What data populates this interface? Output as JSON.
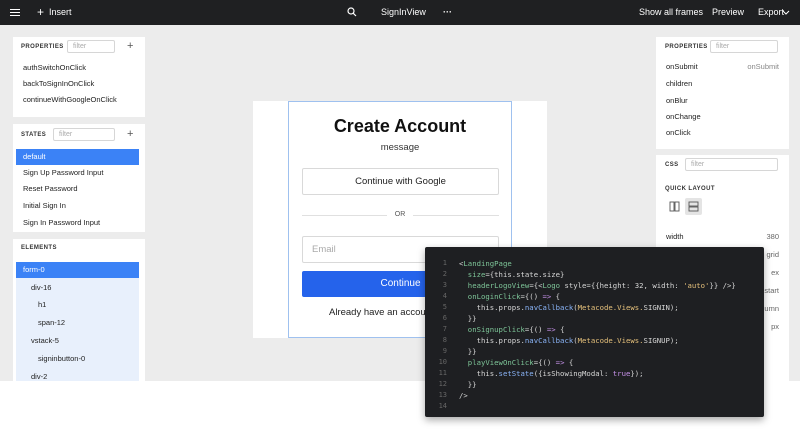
{
  "topbar": {
    "insert_label": "Insert",
    "view_name": "SignInView",
    "more_label": "···",
    "show_all_frames": "Show all frames",
    "preview": "Preview",
    "export": "Export"
  },
  "left_properties": {
    "title": "PROPERTIES",
    "filter_placeholder": "filter",
    "items": [
      "authSwitchOnClick",
      "backToSignInOnClick",
      "continueWithGoogleOnClick"
    ]
  },
  "states": {
    "title": "STATES",
    "filter_placeholder": "filter",
    "items": [
      "default",
      "Sign Up Password Input",
      "Reset Password",
      "Initial Sign In",
      "Sign In Password Input"
    ]
  },
  "elements": {
    "title": "ELEMENTS",
    "items": [
      "form-0",
      "div-16",
      "h1",
      "span-12",
      "vstack-5",
      "signinbutton-0",
      "div-2"
    ]
  },
  "right_properties": {
    "title": "PROPERTIES",
    "filter_placeholder": "filter",
    "items": [
      {
        "name": "onSubmit",
        "value": "onSubmit"
      },
      {
        "name": "children",
        "value": ""
      },
      {
        "name": "onBlur",
        "value": ""
      },
      {
        "name": "onChange",
        "value": ""
      },
      {
        "name": "onClick",
        "value": ""
      }
    ]
  },
  "css_panel": {
    "title": "CSS",
    "filter_placeholder": "filter",
    "quick_layout": "QUICK LAYOUT",
    "rows": [
      {
        "name": "width",
        "value": "380"
      },
      {
        "name": "",
        "value": "grid"
      },
      {
        "name": "",
        "value": "ex"
      },
      {
        "name": "",
        "value": "start"
      },
      {
        "name": "",
        "value": "umn"
      },
      {
        "name": "",
        "value": "px"
      }
    ]
  },
  "form": {
    "title": "Create Account",
    "message": "message",
    "google_button": "Continue with Google",
    "divider": "OR",
    "email_placeholder": "Email",
    "continue_button": "Continue",
    "footer": "Already have an accou"
  },
  "code": {
    "line_numbers": [
      "1",
      "2",
      "3",
      "4",
      "5",
      "6",
      "7",
      "8",
      "9",
      "10",
      "11",
      "12",
      "13",
      "14"
    ]
  },
  "colors": {
    "topbar": "#1f2022",
    "selected": "#3b82f6",
    "primary_button": "#2563eb",
    "code_bg": "#1e1f22"
  }
}
